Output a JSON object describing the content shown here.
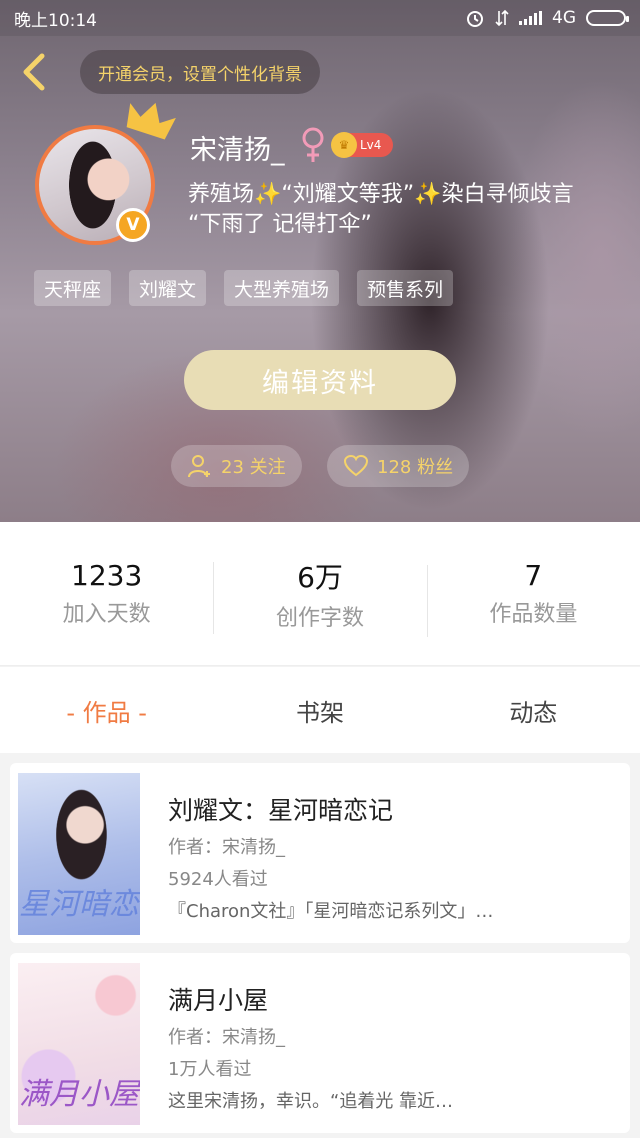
{
  "status_bar": {
    "time": "晚上10:14",
    "network": "4G"
  },
  "header": {
    "vip_banner": "开通会员，设置个性化背景",
    "username": "宋清扬_",
    "gender_symbol": "♀",
    "level": "Lv4",
    "verified_badge": "V",
    "bio_line1": "养殖场✨“刘耀文等我”✨染白寻倾歧言",
    "bio_line2": "“下雨了 记得打伞”",
    "tags": [
      "天秤座",
      "刘耀文",
      "大型养殖场",
      "预售系列"
    ],
    "edit_button": "编辑资料",
    "following_label": "23 关注",
    "fans_label": "128 粉丝"
  },
  "stats": [
    {
      "value": "1233",
      "label": "加入天数"
    },
    {
      "value": "6万",
      "label": "创作字数"
    },
    {
      "value": "7",
      "label": "作品数量"
    }
  ],
  "tabs": [
    "- 作品 -",
    "书架",
    "动态"
  ],
  "books": [
    {
      "title": "刘耀文：星河暗恋记",
      "author": "作者：宋清扬_",
      "views": "5924人看过",
      "description": "『Charon文社』「星河暗恋记系列文」…",
      "cover_text": "星河暗恋"
    },
    {
      "title": "满月小屋",
      "author": "作者：宋清扬_",
      "views": "1万人看过",
      "description": "这里宋清扬，幸识。“追着光 靠近…",
      "cover_text": "满月小屋"
    }
  ],
  "colors": {
    "accent": "#f07b43",
    "gold": "#f5d36a",
    "edit_button": "#e8ddb5"
  }
}
